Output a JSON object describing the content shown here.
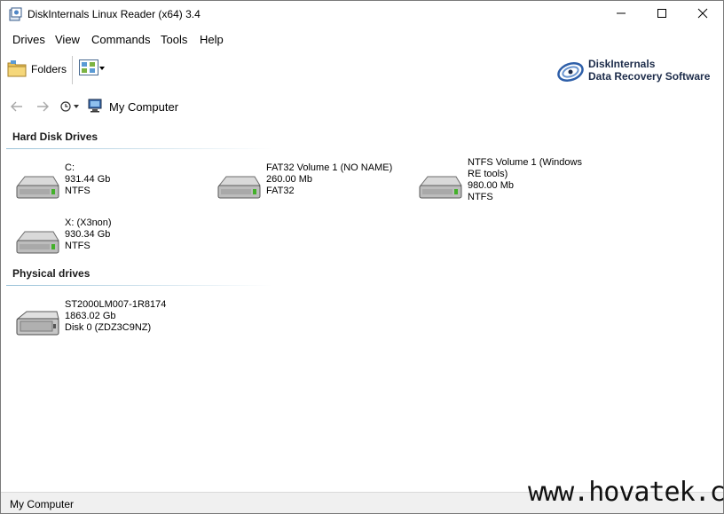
{
  "window": {
    "title": "DiskInternals Linux Reader (x64) 3.4"
  },
  "menu": {
    "items": [
      "Drives",
      "View",
      "Commands",
      "Tools",
      "Help"
    ]
  },
  "toolbar": {
    "folders_label": "Folders",
    "brand_line1": "DiskInternals",
    "brand_line2": "Data Recovery Software"
  },
  "address": {
    "location": "My Computer"
  },
  "sections": {
    "hard_disk": {
      "title": "Hard Disk Drives",
      "drives": [
        {
          "name": "C:",
          "size": "931.44 Gb",
          "fs": "NTFS"
        },
        {
          "name": "FAT32 Volume 1 (NO NAME)",
          "size": "260.00 Mb",
          "fs": "FAT32"
        },
        {
          "name": "NTFS Volume 1 (Windows RE tools)",
          "size": "980.00 Mb",
          "fs": "NTFS"
        },
        {
          "name": "X: (X3non)",
          "size": "930.34 Gb",
          "fs": "NTFS"
        }
      ]
    },
    "physical": {
      "title": "Physical drives",
      "drives": [
        {
          "name": "ST2000LM007-1R8174",
          "size": "1863.02 Gb",
          "fs": "Disk 0 (ZDZ3C9NZ)"
        }
      ]
    }
  },
  "status": {
    "text": "My Computer"
  },
  "watermark": "www.hovatek.com",
  "colors": {
    "accent": "#9ac2d8",
    "brand": "#1d2c4a",
    "status_bg": "#f0f0f0"
  }
}
